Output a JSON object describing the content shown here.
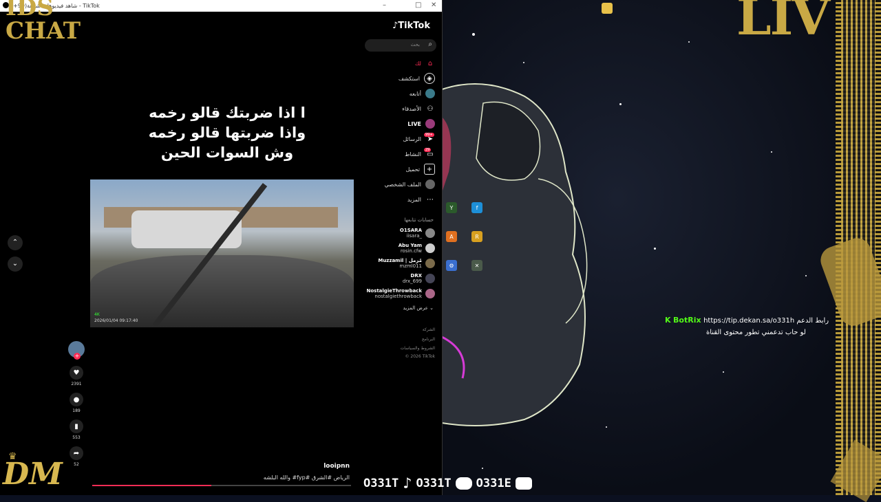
{
  "window": {
    "title": "شاهد فيديوهات شائعة(99+) - TikTok",
    "controls": [
      "–",
      "□",
      "✕"
    ]
  },
  "tiktok": {
    "logo": "TikTok",
    "search_placeholder": "بحث",
    "nav": [
      {
        "label": "لك",
        "icon": "home-icon"
      },
      {
        "label": "استكشف",
        "icon": "compass-icon"
      },
      {
        "label": "أتابعه",
        "icon": "avatar-icon"
      },
      {
        "label": "الأصدقاء",
        "icon": "friends-icon"
      },
      {
        "label": "LIVE",
        "icon": "live-icon"
      },
      {
        "label": "الرسائل",
        "icon": "messages-icon",
        "badge": "99+"
      },
      {
        "label": "النشاط",
        "icon": "activity-icon",
        "badge": "29"
      },
      {
        "label": "تحميل",
        "icon": "upload-icon"
      },
      {
        "label": "الملف الشخصي",
        "icon": "profile-icon"
      },
      {
        "label": "المزيد",
        "icon": "more-icon"
      }
    ],
    "following_header": "حسابات تتابعها",
    "following": [
      {
        "name": "O1SARA",
        "handle": "iisara_"
      },
      {
        "name": "Abu Yam",
        "handle": "rosin.cfw"
      },
      {
        "name": "Muzzamil | مُزمل",
        "handle": "mzml011"
      },
      {
        "name": "DRX",
        "handle": "drx_699"
      },
      {
        "name": "NostalgieThrowback",
        "handle": "nostalgiethrowback"
      }
    ],
    "see_more": "عرض المزيد",
    "footer": [
      "الشركة",
      "البرنامج",
      "الشروط والسياسات",
      "© 2026 TikTok"
    ],
    "video": {
      "caption_lines": [
        "ا اذا ضربتك قالو رخمه",
        "واذا ضربتها قالو رخمه",
        "وش السوات الحين"
      ],
      "cam_tag": "4K",
      "cam_timestamp": "2026/01/04 09:17:40",
      "author": "looipnn",
      "description": "والله البلشه #fyp# الرياض #الشرق"
    },
    "actions": [
      {
        "icon": "heart-icon",
        "count": "2391"
      },
      {
        "icon": "comment-icon",
        "count": "189"
      },
      {
        "icon": "bookmark-icon",
        "count": "553"
      },
      {
        "icon": "share-icon",
        "count": "52"
      }
    ],
    "progress": 0.46
  },
  "overlay": {
    "logo_top_left": "IDS CHAT",
    "logo_bottom_left": "DM",
    "top_right_text": "LIV",
    "bottom_handles": [
      "O331T",
      "O331T",
      "O331E"
    ],
    "chat": {
      "user": "BotRix",
      "line1": "https://tip.dekan.sa/o331h رابط الدعم",
      "line2": "لو حاب تدعمني تطور محتوى القناة"
    }
  },
  "colors": {
    "tiktok_red": "#fe2c55",
    "gold": "#c9a945",
    "botrix_green": "#53fc18"
  }
}
